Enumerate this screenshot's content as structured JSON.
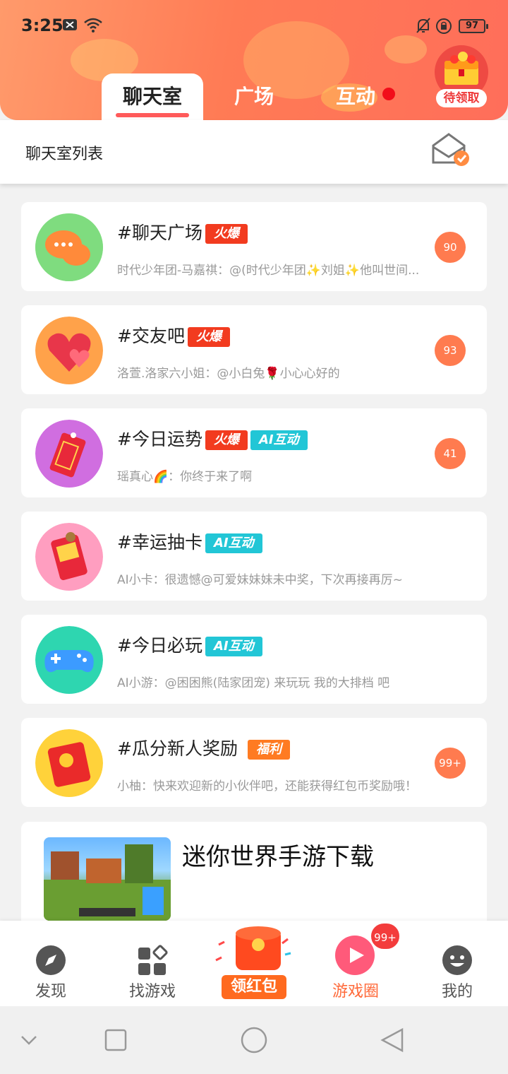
{
  "status_bar": {
    "time": "3:25",
    "battery": "97"
  },
  "tabs": [
    {
      "label": "聊天室",
      "active": true
    },
    {
      "label": "广场",
      "active": false
    },
    {
      "label": "互动",
      "active": false,
      "has_dot": true
    }
  ],
  "reward": {
    "label": "待领取"
  },
  "subheader": {
    "title": "聊天室列表"
  },
  "rooms": [
    {
      "title": "#聊天广场",
      "tags": [
        "火爆"
      ],
      "message": "时代少年团-马嘉祺：@(时代少年团✨刘姐✨他叫世间...",
      "count": "90"
    },
    {
      "title": "#交友吧",
      "tags": [
        "火爆"
      ],
      "message": "洛萱.洛家六小姐：@小白兔🌹小心心好的",
      "count": "93"
    },
    {
      "title": "#今日运势",
      "tags": [
        "火爆",
        "AI互动"
      ],
      "message": "瑶真心🌈：你终于来了啊",
      "count": "41"
    },
    {
      "title": "#幸运抽卡",
      "tags": [
        "AI互动"
      ],
      "message": "AI小卡：很遗憾@可爱妹妹妹未中奖，下次再接再厉~",
      "count": ""
    },
    {
      "title": "#今日必玩",
      "tags": [
        "AI互动"
      ],
      "message": "AI小游：@困困熊(陆家团宠) 来玩玩 我的大排档 吧",
      "count": ""
    },
    {
      "title": "#瓜分新人奖励",
      "tags": [
        "福利"
      ],
      "message": "小柚：快来欢迎新的小伙伴吧，还能获得红包币奖励哦！",
      "count": "99+"
    }
  ],
  "ad": {
    "title": "迷你世界手游下载"
  },
  "bottom_nav": [
    {
      "label": "发现",
      "icon": "compass-icon"
    },
    {
      "label": "找游戏",
      "icon": "apps-icon"
    },
    {
      "label": "领红包",
      "icon": "red-packet-icon"
    },
    {
      "label": "游戏圈",
      "icon": "game-circle-icon",
      "badge": "99+"
    },
    {
      "label": "我的",
      "icon": "profile-face-icon"
    }
  ],
  "colors": {
    "accent": "#ff7b55",
    "hot": "#f23b1f",
    "ai": "#22c6d6",
    "fuli": "#ff7b22",
    "count": "#ff7b4f"
  }
}
